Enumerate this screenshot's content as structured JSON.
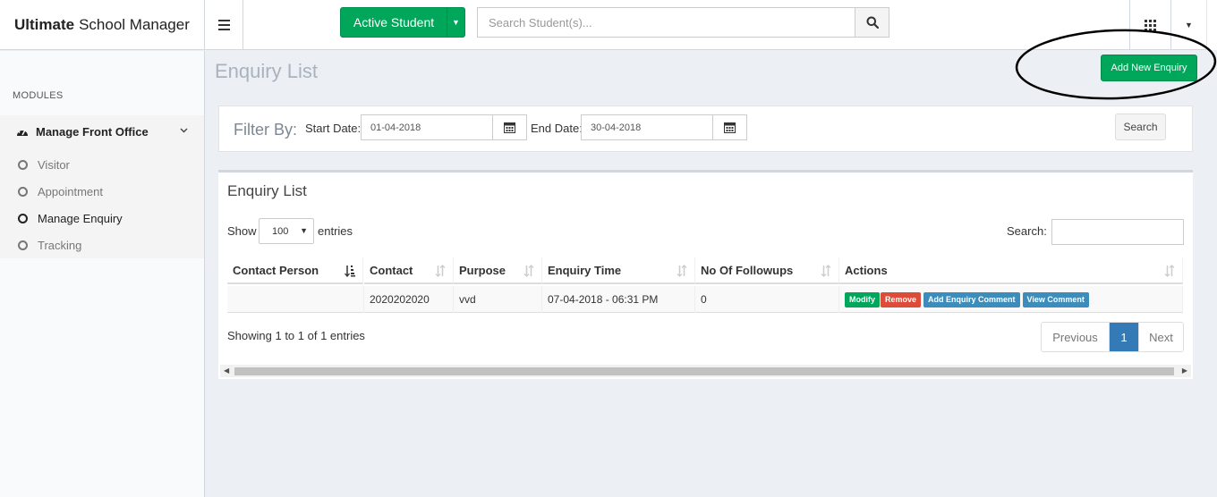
{
  "app": {
    "brand_bold": "Ultimate",
    "brand_rest": "School Manager"
  },
  "header": {
    "active_student_label": "Active Student",
    "search_placeholder": "Search Student(s)..."
  },
  "sidebar": {
    "modules_heading": "MODULES",
    "menu_title": "Manage Front Office",
    "items": [
      {
        "label": "Visitor",
        "active": false
      },
      {
        "label": "Appointment",
        "active": false
      },
      {
        "label": "Manage Enquiry",
        "active": true
      },
      {
        "label": "Tracking",
        "active": false
      }
    ]
  },
  "page": {
    "title": "Enquiry List",
    "add_button": "Add New Enquiry"
  },
  "filter": {
    "label": "Filter By:",
    "start_label": "Start Date:",
    "start_value": "01-04-2018",
    "end_label": "End Date:",
    "end_value": "30-04-2018",
    "search_button": "Search"
  },
  "list": {
    "title": "Enquiry List",
    "show_label": "Show",
    "show_value": "100",
    "entries_label": "entries",
    "search_label": "Search:",
    "columns": [
      "Contact Person",
      "Contact",
      "Purpose",
      "Enquiry Time",
      "No Of Followups",
      "Actions"
    ],
    "rows": [
      {
        "contact_person": "",
        "contact": "2020202020",
        "purpose": "vvd",
        "enquiry_time": "07-04-2018 - 06:31 PM",
        "followups": "0"
      }
    ],
    "actions": {
      "modify": "Modify",
      "remove": "Remove",
      "add_comment": "Add Enquiry Comment",
      "view_comment": "View Comment"
    },
    "showing_text": "Showing 1 to 1 of 1 entries",
    "pager": {
      "previous": "Previous",
      "current": "1",
      "next": "Next"
    }
  },
  "colors": {
    "primary_green": "#00a65a",
    "danger_red": "#dd4b39",
    "info_blue": "#3c8dbc",
    "page_active_blue": "#337ab7"
  }
}
